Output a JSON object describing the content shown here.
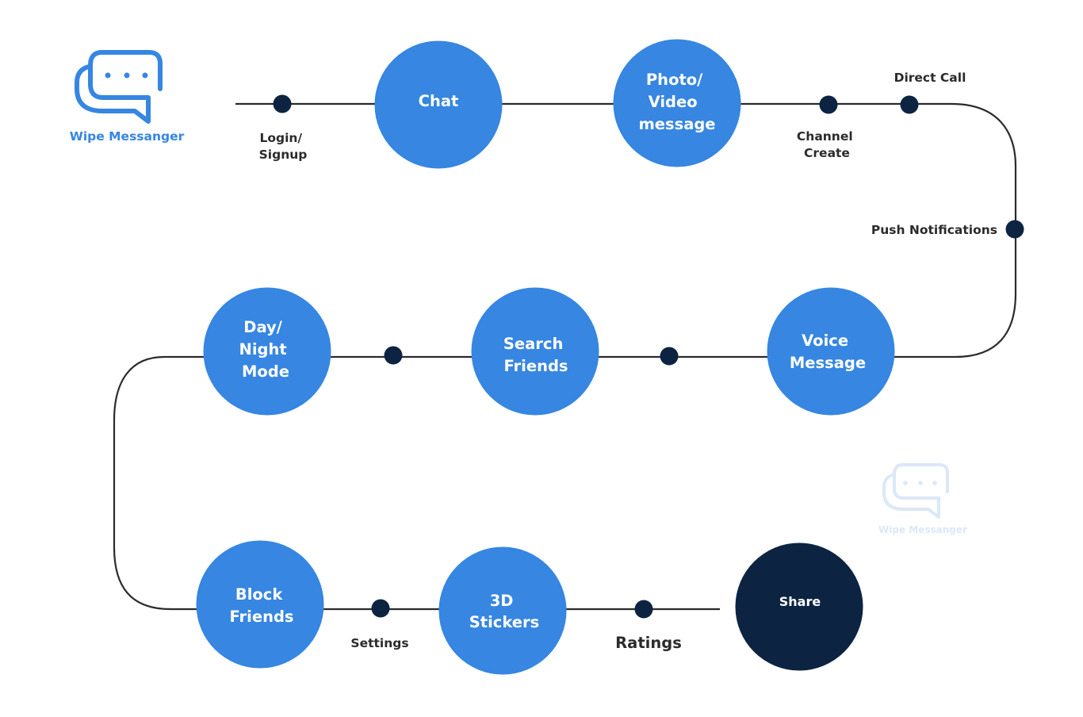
{
  "colors": {
    "node_blue": "#3686E2",
    "node_dark": "#0C2442",
    "dot": "#0C2442",
    "line": "#2b2b2b",
    "label": "#2b2b2b",
    "logo": "#3686E2",
    "watermark": "#DCE8F8"
  },
  "logo": {
    "name": "Wipe Messanger",
    "icon": "chat-bubbles-icon"
  },
  "watermark": {
    "name": "Wipe Messanger",
    "icon": "chat-bubbles-icon"
  },
  "nodes": [
    {
      "id": "chat",
      "lines": [
        "Chat"
      ],
      "style": "blue"
    },
    {
      "id": "photo-video-message",
      "lines": [
        "Photo/",
        "Video",
        "message"
      ],
      "style": "blue"
    },
    {
      "id": "voice-message",
      "lines": [
        "Voice",
        "Message"
      ],
      "style": "blue"
    },
    {
      "id": "search-friends",
      "lines": [
        "Search",
        "Friends"
      ],
      "style": "blue"
    },
    {
      "id": "day-night-mode",
      "lines": [
        "Day/",
        "Night",
        "Mode"
      ],
      "style": "blue"
    },
    {
      "id": "block-friends",
      "lines": [
        "Block",
        "Friends"
      ],
      "style": "blue"
    },
    {
      "id": "3d-stickers",
      "lines": [
        "3D",
        "Stickers"
      ],
      "style": "blue"
    },
    {
      "id": "share",
      "lines": [
        "Share"
      ],
      "style": "dark"
    }
  ],
  "steps": [
    {
      "id": "login-signup",
      "lines": [
        "Login/",
        "Signup"
      ]
    },
    {
      "id": "channel-create",
      "lines": [
        "Channel",
        "Create"
      ]
    },
    {
      "id": "direct-call",
      "lines": [
        "Direct Call"
      ]
    },
    {
      "id": "push-notifications",
      "lines": [
        "Push Notifications"
      ]
    },
    {
      "id": "unlabeled-1",
      "lines": []
    },
    {
      "id": "unlabeled-2",
      "lines": []
    },
    {
      "id": "settings",
      "lines": [
        "Settings"
      ]
    },
    {
      "id": "ratings",
      "lines": [
        "Ratings"
      ]
    }
  ]
}
